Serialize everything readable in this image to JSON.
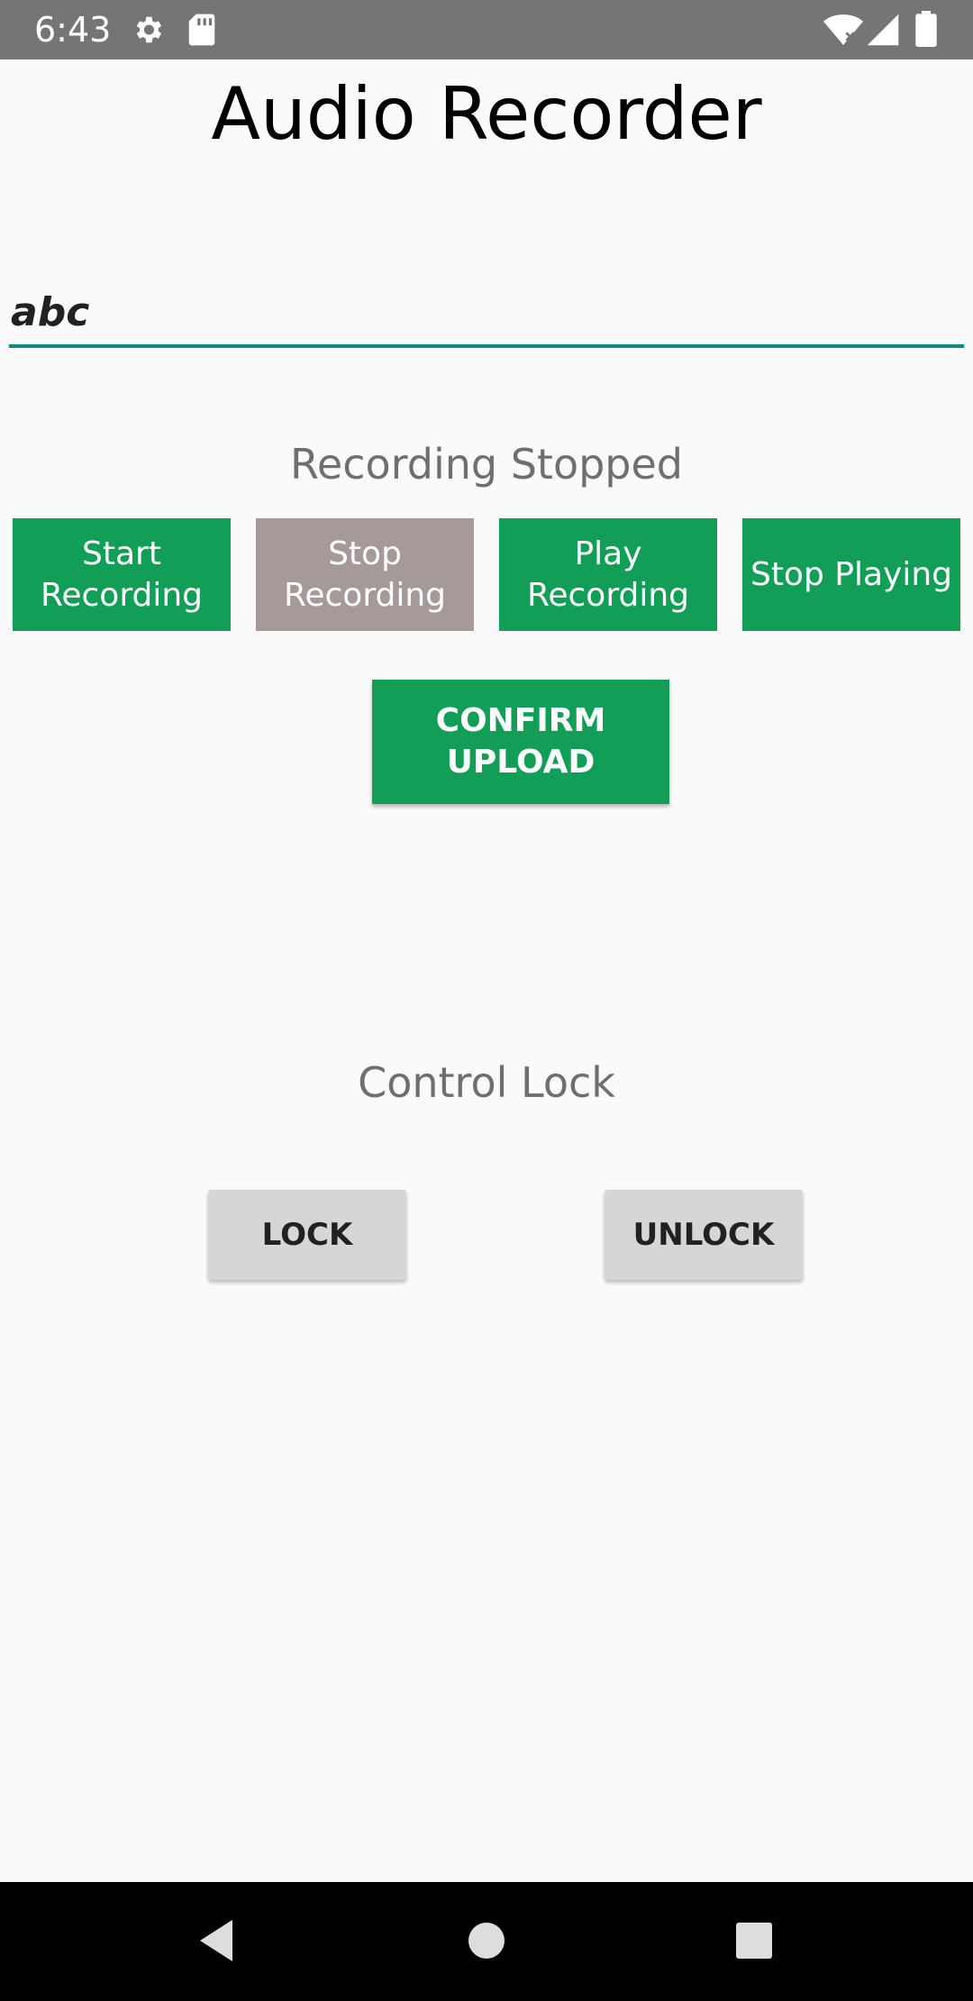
{
  "status_bar": {
    "time": "6:43",
    "icons": [
      "settings-gear-icon",
      "sd-card-icon",
      "wifi-icon",
      "cell-signal-icon",
      "battery-icon"
    ],
    "background": "#757575"
  },
  "app": {
    "title": "Audio Recorder"
  },
  "name_input": {
    "value": "abc",
    "underline_color": "#0f8a7e"
  },
  "recording_status": "Recording Stopped",
  "recording_buttons": [
    {
      "label": "Start Recording",
      "enabled": true,
      "color": "#129e57"
    },
    {
      "label": "Stop Recording",
      "enabled": false,
      "color": "#a59999"
    },
    {
      "label": "Play Recording",
      "enabled": true,
      "color": "#129e57"
    },
    {
      "label": "Stop Playing",
      "enabled": true,
      "color": "#129e57"
    }
  ],
  "confirm_upload": {
    "label": "CONFIRM UPLOAD",
    "color": "#129e57"
  },
  "control_lock": {
    "label": "Control Lock",
    "lock_label": "LOCK",
    "unlock_label": "UNLOCK"
  },
  "nav_bar": {
    "icons": [
      "back-icon",
      "home-icon",
      "recents-icon"
    ]
  }
}
